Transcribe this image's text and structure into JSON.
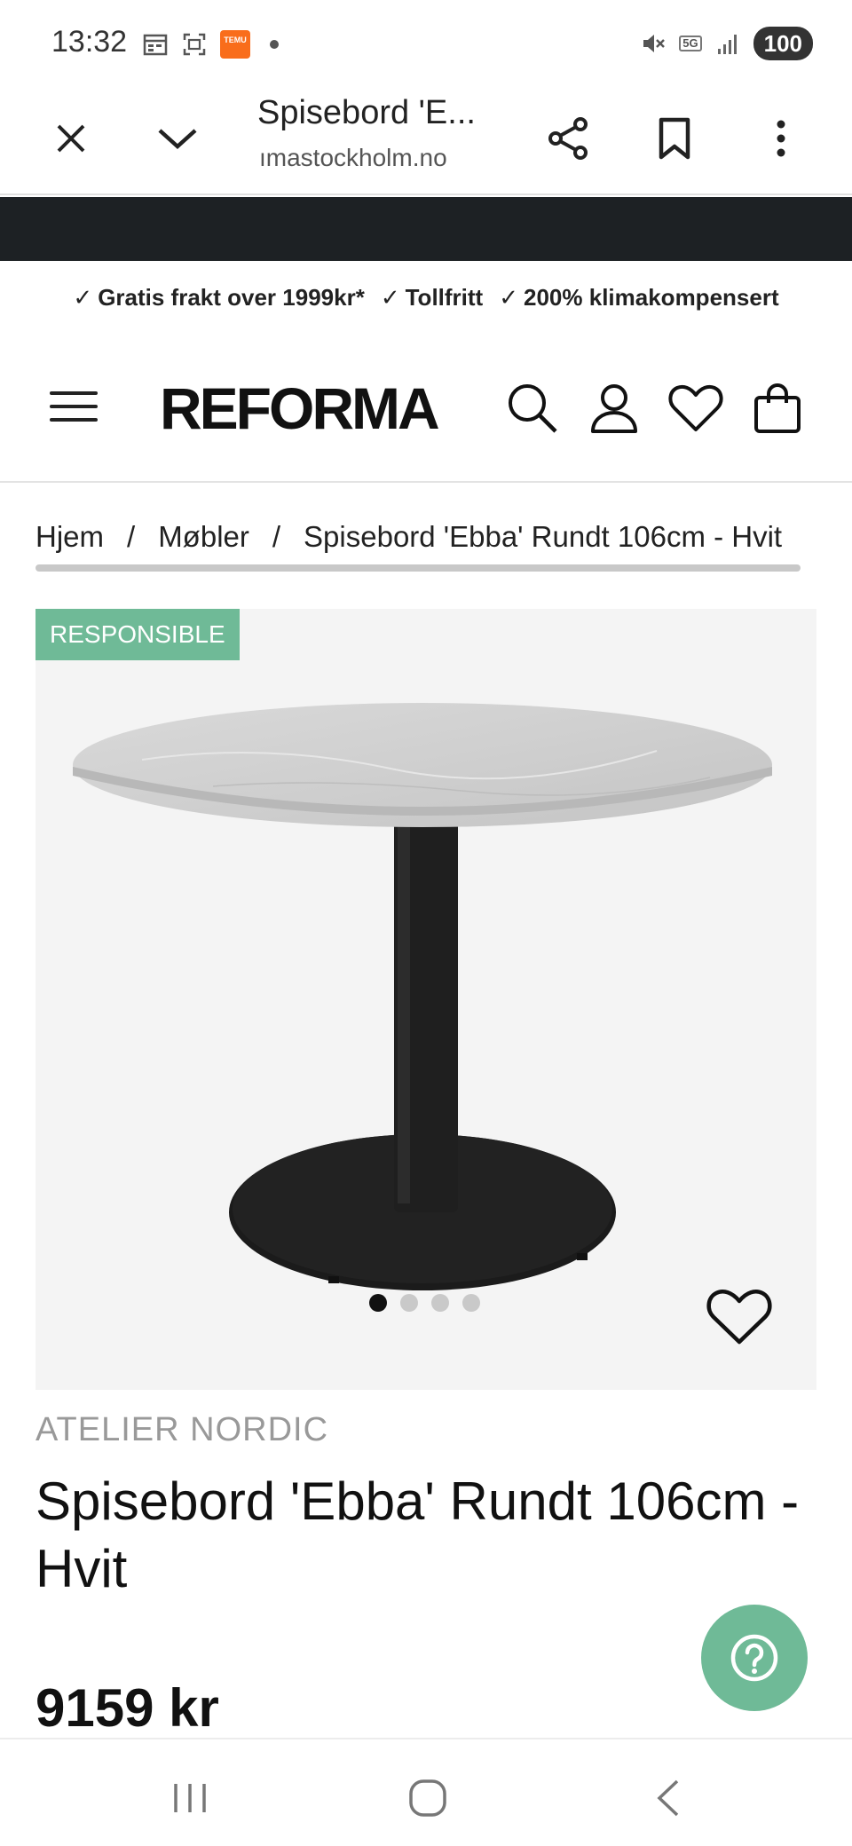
{
  "status_bar": {
    "time": "13:32",
    "battery": "100",
    "network": "5G",
    "icons": [
      "calendar-icon",
      "screenshot-icon",
      "temu-icon",
      "mute-icon",
      "signal-icon"
    ],
    "temu_label": "TEMU"
  },
  "browser": {
    "title": "Spisebord 'E...",
    "url": "ımastockholm.no",
    "icons": [
      "close-icon",
      "chevron-down-icon",
      "share-icon",
      "bookmark-icon",
      "more-icon"
    ]
  },
  "usp": {
    "items": [
      "Gratis frakt over 1999kr*",
      "Tollfritt",
      "200% klimakompensert"
    ]
  },
  "header": {
    "logo": "REFORMA",
    "icons": [
      "menu-icon",
      "search-icon",
      "account-icon",
      "wishlist-icon",
      "cart-icon"
    ]
  },
  "breadcrumb": {
    "items": [
      "Hjem",
      "Møbler",
      "Spisebord 'Ebba' Rundt 106cm - Hvit"
    ],
    "separator": "/"
  },
  "gallery": {
    "badge": "RESPONSIBLE",
    "image_count": 4,
    "active_index": 0
  },
  "product": {
    "brand": "ATELIER NORDIC",
    "title": "Spisebord 'Ebba' Rundt 106cm - Hvit",
    "price": "9159 kr"
  },
  "nav": {
    "icons": [
      "recent-apps-icon",
      "home-icon",
      "back-icon"
    ]
  },
  "colors": {
    "accent": "#6fba97",
    "dark_bar": "#1d2124"
  }
}
